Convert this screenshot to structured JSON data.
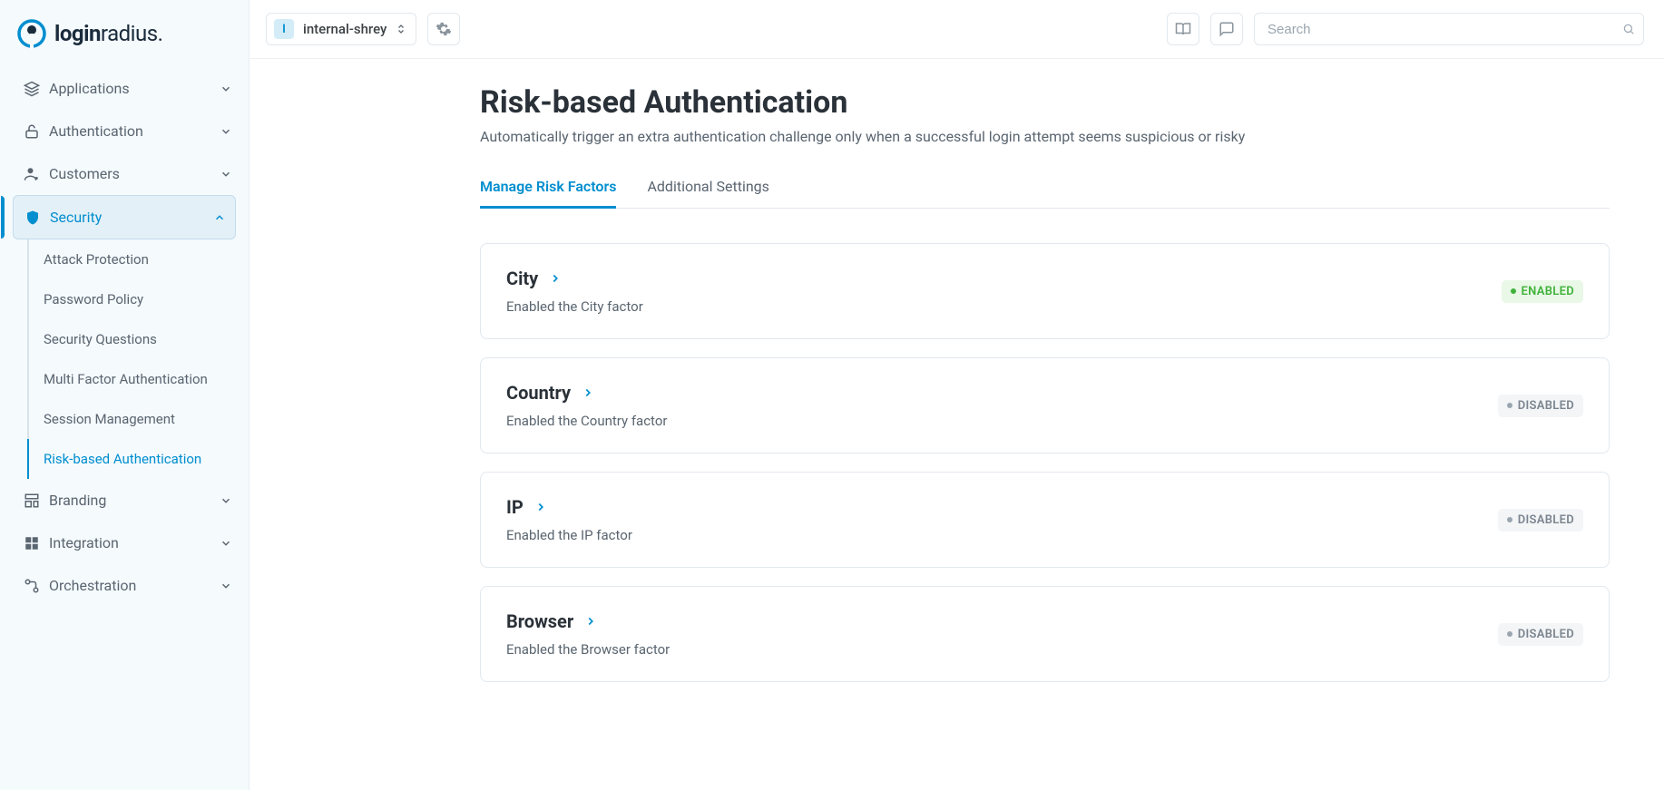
{
  "brand": {
    "name_bold": "login",
    "name_light": "radius."
  },
  "sidebar": {
    "items": [
      {
        "label": "Applications",
        "icon": "layers"
      },
      {
        "label": "Authentication",
        "icon": "lock"
      },
      {
        "label": "Customers",
        "icon": "user"
      },
      {
        "label": "Security",
        "icon": "shield",
        "active": true
      },
      {
        "label": "Branding",
        "icon": "theme"
      },
      {
        "label": "Integration",
        "icon": "grid"
      },
      {
        "label": "Orchestration",
        "icon": "flow"
      }
    ],
    "security_sub": [
      {
        "label": "Attack Protection"
      },
      {
        "label": "Password Policy"
      },
      {
        "label": "Security Questions"
      },
      {
        "label": "Multi Factor Authentication"
      },
      {
        "label": "Session Management"
      },
      {
        "label": "Risk-based Authentication",
        "active": true
      }
    ]
  },
  "topbar": {
    "app_initial": "I",
    "app_name": "internal-shrey",
    "search_placeholder": "Search"
  },
  "page": {
    "title": "Risk-based Authentication",
    "subtitle": "Automatically trigger an extra authentication challenge only when a successful login attempt seems suspicious or risky"
  },
  "tabs": [
    {
      "label": "Manage Risk Factors",
      "active": true
    },
    {
      "label": "Additional Settings"
    }
  ],
  "status": {
    "enabled_label": "ENABLED",
    "disabled_label": "DISABLED"
  },
  "factors": [
    {
      "title": "City",
      "desc": "Enabled the City factor",
      "enabled": true
    },
    {
      "title": "Country",
      "desc": "Enabled the Country factor",
      "enabled": false
    },
    {
      "title": "IP",
      "desc": "Enabled the IP factor",
      "enabled": false
    },
    {
      "title": "Browser",
      "desc": "Enabled the Browser factor",
      "enabled": false
    }
  ]
}
